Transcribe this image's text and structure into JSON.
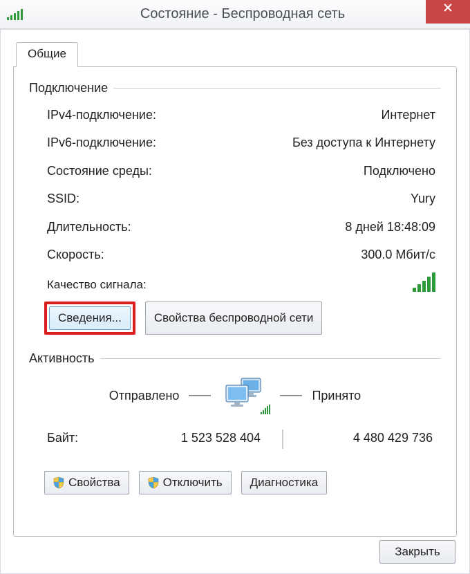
{
  "window": {
    "title": "Состояние - Беспроводная сеть",
    "tab_label": "Общие"
  },
  "connection": {
    "legend": "Подключение",
    "rows": [
      {
        "label": "IPv4-подключение:",
        "value": "Интернет"
      },
      {
        "label": "IPv6-подключение:",
        "value": "Без доступа к Интернету"
      },
      {
        "label": "Состояние среды:",
        "value": "Подключено"
      },
      {
        "label": "SSID:",
        "value": "Yury"
      },
      {
        "label": "Длительность:",
        "value": "8 дней 18:48:09"
      },
      {
        "label": "Скорость:",
        "value": "300.0 Мбит/с"
      }
    ],
    "signal_label": "Качество сигнала:",
    "buttons": {
      "details": "Сведения...",
      "wireless_props": "Свойства беспроводной сети"
    }
  },
  "activity": {
    "legend": "Активность",
    "sent_label": "Отправлено",
    "received_label": "Принято",
    "bytes_label": "Байт:",
    "bytes_sent": "1 523 528 404",
    "bytes_received": "4 480 429 736"
  },
  "buttons": {
    "properties": "Свойства",
    "disable": "Отключить",
    "diagnose": "Диагностика",
    "close": "Закрыть"
  }
}
